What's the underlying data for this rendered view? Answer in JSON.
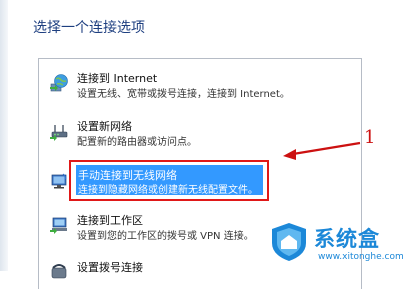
{
  "heading": "选择一个连接选项",
  "options": [
    {
      "title": "连接到 Internet",
      "desc": "设置无线、宽带或拨号连接，连接到 Internet。",
      "icon": "globe-network-icon"
    },
    {
      "title": "设置新网络",
      "desc": "配置新的路由器或访问点。",
      "icon": "router-icon"
    },
    {
      "title": "手动连接到无线网络",
      "desc": "连接到隐藏网络或创建新无线配置文件。",
      "icon": "wireless-monitor-icon",
      "selected": true
    },
    {
      "title": "连接到工作区",
      "desc": "设置到您的工作区的拨号或 VPN 连接。",
      "icon": "workplace-icon"
    },
    {
      "title": "设置拨号连接",
      "desc": "",
      "icon": "dialup-phone-icon"
    }
  ],
  "annotation": {
    "number": "1",
    "color": "#cc1111"
  },
  "watermark": {
    "name": "系统盒",
    "url": "www.xitonghe.com",
    "color": "#1c88d8"
  },
  "colors": {
    "heading": "#1e3f80",
    "selection": "#3399ff",
    "highlight_border": "#e01818"
  }
}
